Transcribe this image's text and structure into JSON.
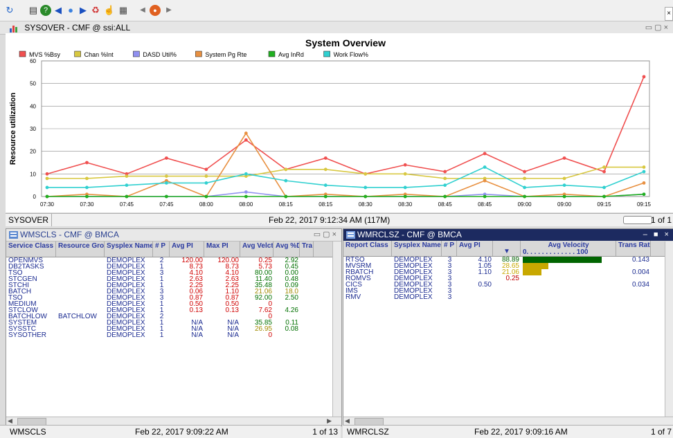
{
  "toolbar": {
    "icons": [
      "refresh-icon",
      "print-icon",
      "help-icon",
      "back-arrow-icon",
      "circle-icon",
      "forward-arrow-icon",
      "recycle-icon",
      "cursor-icon",
      "calculator-icon",
      "prev-arrow-icon",
      "stop-icon",
      "next-arrow-icon"
    ]
  },
  "main_window": {
    "title": "SYSOVER - CMF @ ssi:ALL"
  },
  "chart_data": {
    "type": "line",
    "title": "System Overview",
    "ylabel": "Resource utilization",
    "xlabel": "",
    "ylim": [
      0,
      60
    ],
    "yticks": [
      0,
      10,
      20,
      30,
      40,
      50,
      60
    ],
    "x": [
      "07:30",
      "07:30",
      "07:45",
      "07:45",
      "08:00",
      "08:00",
      "08:15",
      "08:15",
      "08:30",
      "08:30",
      "08:45",
      "08:45",
      "09:00",
      "09:00",
      "09:15",
      "09:15"
    ],
    "legend_position": "top",
    "grid": true,
    "series": [
      {
        "name": "MVS %Bsy",
        "color": "#f05050",
        "values": [
          10,
          15,
          10,
          17,
          12,
          25,
          12,
          17,
          10,
          14,
          11,
          19,
          11,
          17,
          11,
          53
        ]
      },
      {
        "name": "Chan %Int",
        "color": "#d8c840",
        "values": [
          8,
          8,
          9,
          9,
          9,
          9,
          12,
          12,
          10,
          10,
          8,
          8,
          8,
          8,
          13,
          13
        ]
      },
      {
        "name": "DASD Util%",
        "color": "#9090f0",
        "values": [
          0,
          0,
          0,
          0,
          0,
          2,
          0,
          0,
          0,
          0,
          0,
          1,
          0,
          0,
          0,
          1
        ]
      },
      {
        "name": "System Pg Rte",
        "color": "#e89040",
        "values": [
          0,
          1,
          0,
          7,
          0,
          28,
          0,
          1,
          0,
          1,
          0,
          7,
          0,
          1,
          0,
          6
        ]
      },
      {
        "name": "Avg InRd",
        "color": "#20b020",
        "values": [
          0,
          0,
          0,
          0,
          0,
          0,
          0,
          0,
          0,
          0,
          0,
          0,
          0,
          0,
          0,
          1
        ]
      },
      {
        "name": "Work Flow%",
        "color": "#30d0d0",
        "values": [
          4,
          4,
          5,
          6,
          6,
          10,
          7,
          5,
          4,
          4,
          5,
          13,
          4,
          5,
          4,
          11
        ]
      }
    ]
  },
  "main_status": {
    "name": "SYSOVER",
    "timestamp": "Feb 22, 2017 9:12:34 AM (117M)",
    "pages": "1 of 1"
  },
  "left_panel": {
    "title": "WMSCLS - CMF @ BMCA",
    "headers": [
      "Service Class",
      "Resource Group",
      "Sysplex Name",
      "# P",
      "Avg PI",
      "Max PI",
      "Avg Velcty",
      "Avg %Dly",
      "Tra Ra"
    ],
    "rows": [
      {
        "c": [
          "OPENMVS",
          "",
          "DEMOPLEX",
          "2",
          "120.00",
          "120.00",
          "0.25",
          "2.92"
        ]
      },
      {
        "c": [
          "DB2TASKS",
          "",
          "DEMOPLEX",
          "1",
          "8.73",
          "8.73",
          "5.73",
          "0.45"
        ]
      },
      {
        "c": [
          "TSO",
          "",
          "DEMOPLEX",
          "3",
          "4.10",
          "4.10",
          "80.00",
          "0.00"
        ]
      },
      {
        "c": [
          "STCGEN",
          "",
          "DEMOPLEX",
          "1",
          "2.63",
          "2.63",
          "11.40",
          "0.48"
        ]
      },
      {
        "c": [
          "STCHI",
          "",
          "DEMOPLEX",
          "1",
          "2.25",
          "2.25",
          "35.48",
          "0.09"
        ]
      },
      {
        "c": [
          "BATCH",
          "",
          "DEMOPLEX",
          "3",
          "0.06",
          "1.10",
          "21.06",
          "18.0"
        ]
      },
      {
        "c": [
          "TSO",
          "",
          "DEMOPLEX",
          "3",
          "0.87",
          "0.87",
          "92.00",
          "2.50"
        ]
      },
      {
        "c": [
          "MEDIUM",
          "",
          "DEMOPLEX",
          "1",
          "0.50",
          "0.50",
          "0",
          ""
        ]
      },
      {
        "c": [
          "STCLOW",
          "",
          "DEMOPLEX",
          "1",
          "0.13",
          "0.13",
          "7.62",
          "4.26"
        ]
      },
      {
        "c": [
          "BATCHLOW",
          "BATCHLOW",
          "DEMOPLEX",
          "2",
          "",
          "",
          "0",
          ""
        ]
      },
      {
        "c": [
          "SYSTEM",
          "",
          "DEMOPLEX",
          "1",
          "N/A",
          "N/A",
          "35.85",
          "0.11"
        ]
      },
      {
        "c": [
          "SYSSTC",
          "",
          "DEMOPLEX",
          "1",
          "N/A",
          "N/A",
          "26.95",
          "0.08"
        ]
      },
      {
        "c": [
          "SYSOTHER",
          "",
          "DEMOPLEX",
          "1",
          "N/A",
          "N/A",
          "0",
          ""
        ]
      }
    ],
    "status": {
      "name": "WMSCLS",
      "timestamp": "Feb 22, 2017 9:09:22 AM",
      "pages": "1 of 13"
    }
  },
  "right_panel": {
    "title": "WMRCLSZ - CMF @ BMCA",
    "headers": [
      "Report Class",
      "Sysplex Name",
      "# P",
      "Avg PI",
      "",
      "Avg Velocity",
      "Trans Rate"
    ],
    "velocity_scale": "0. . . . . . . . . . . . . 100",
    "rows": [
      {
        "c": [
          "RTSO",
          "DEMOPLEX",
          "3",
          "4.10",
          "88.89"
        ],
        "vel": 88.89,
        "color": "#006400",
        "rate": "0.143"
      },
      {
        "c": [
          "MVSRM",
          "DEMOPLEX",
          "3",
          "1.05",
          "28.65"
        ],
        "vel": 28.65,
        "color": "#c8a800",
        "rate": ""
      },
      {
        "c": [
          "RBATCH",
          "DEMOPLEX",
          "3",
          "1.10",
          "21.06"
        ],
        "vel": 21.06,
        "color": "#c8a800",
        "rate": "0.004"
      },
      {
        "c": [
          "ROMVS",
          "DEMOPLEX",
          "3",
          "",
          "0.25"
        ],
        "vel": 0.25,
        "color": "#c00000",
        "rate": ""
      },
      {
        "c": [
          "CICS",
          "DEMOPLEX",
          "3",
          "0.50",
          ""
        ],
        "vel": 0,
        "color": "#c00000",
        "rate": "0.034"
      },
      {
        "c": [
          "IMS",
          "DEMOPLEX",
          "3",
          "",
          ""
        ],
        "vel": 0,
        "color": "#c00000",
        "rate": ""
      },
      {
        "c": [
          "RMV",
          "DEMOPLEX",
          "3",
          "",
          ""
        ],
        "vel": 0,
        "color": "#c00000",
        "rate": ""
      }
    ],
    "status": {
      "name": "WMRCLSZ",
      "timestamp": "Feb 22, 2017 9:09:16 AM",
      "pages": "1 of 7"
    }
  }
}
